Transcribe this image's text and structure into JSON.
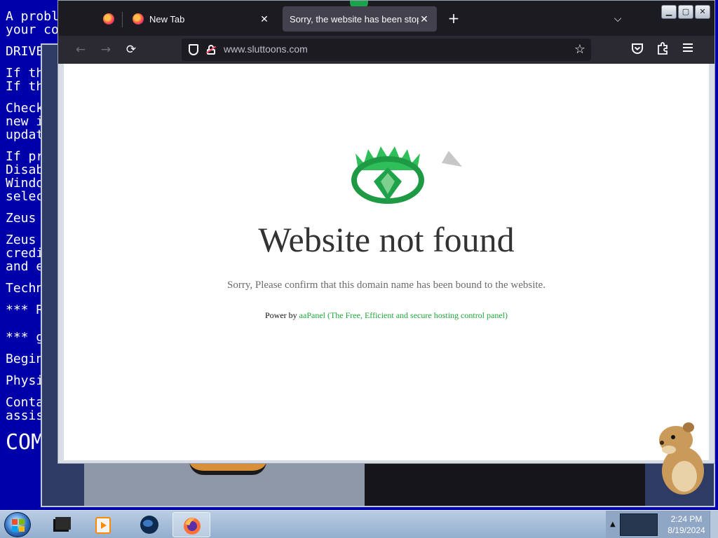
{
  "background_bsod": {
    "lines": [
      "A probl",
      "your co",
      "DRIVE",
      "If th",
      "If th",
      "Check",
      "new i",
      "updat",
      "If pr",
      "Disab",
      "Windo",
      "selec",
      "Zeus",
      "Zeus",
      "credi",
      "and e",
      "Techn",
      "*** R",
      "*** g",
      "Begin",
      "Physi",
      "Conta",
      "assis",
      "COM"
    ]
  },
  "browser": {
    "tabs": [
      {
        "title": "",
        "pinned": true
      },
      {
        "title": "New Tab",
        "close": "✕"
      },
      {
        "title": "Sorry, the website has been stopped",
        "close": "✕",
        "active": true
      }
    ],
    "new_tab_symbol": "+",
    "tab_list_symbol": "⌵",
    "nav": {
      "back": "←",
      "forward": "→",
      "reload": "⟳"
    },
    "url": "www.sluttoons.com",
    "bookmark_symbol": "☆",
    "toolbar_icons": [
      "pocket-icon",
      "extensions-icon",
      "menu-icon"
    ],
    "window_controls": {
      "minimize": "▁",
      "maximize": "▢",
      "close": "✕"
    }
  },
  "page": {
    "headline": "Website not found",
    "subline": "Sorry, Please confirm that this domain name has been bound to the website.",
    "power_prefix": "Power by",
    "power_link": "aaPanel (The Free, Efficient and secure hosting control panel)"
  },
  "taskbar": {
    "apps": [
      "terminal-app",
      "media-player-app",
      "globe-app",
      "firefox-app"
    ],
    "time": "2:24 PM",
    "date": "8/19/2024"
  },
  "colors": {
    "bsod_blue": "#0000aa",
    "aapanel_green": "#20a53a",
    "browser_dark": "#1c1b22"
  }
}
